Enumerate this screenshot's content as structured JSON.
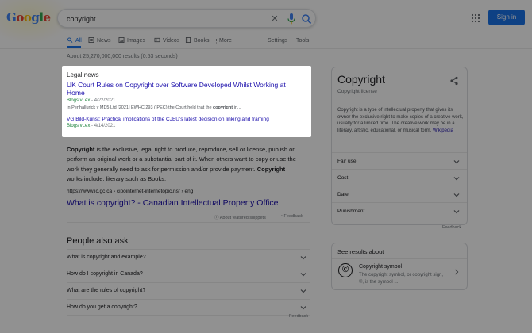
{
  "header": {
    "logo_text": "Google",
    "logo_colors": [
      "#4285f4",
      "#ea4335",
      "#fbbc05",
      "#4285f4",
      "#34a853",
      "#ea4335"
    ],
    "search_value": "copyright",
    "clear_icon": "close-icon",
    "mic_icon": "mic-icon",
    "search_icon": "search-icon",
    "apps_icon": "apps-grid-icon",
    "signin_label": "Sign in"
  },
  "tabs": {
    "items": [
      {
        "label": "All",
        "icon": "search-icon"
      },
      {
        "label": "News",
        "icon": "news-icon"
      },
      {
        "label": "Images",
        "icon": "image-icon"
      },
      {
        "label": "Videos",
        "icon": "video-icon"
      },
      {
        "label": "Books",
        "icon": "book-icon"
      },
      {
        "label": "More",
        "icon": "more-vert-icon"
      }
    ],
    "settings_label": "Settings",
    "tools_label": "Tools"
  },
  "result_stats": "About 25,270,000,000 results (0.53 seconds)",
  "legal_news": {
    "heading": "Legal news",
    "items": [
      {
        "title": "UK Court Rules on Copyright over Software Developed Whilst Working at Home",
        "source": "Blogs vLex",
        "date": " - 4/22/2021",
        "snippet_pre": "In Penhallurick v MD5 Ltd [2021] EWHC 293 (IPEC) the Court held that the ",
        "snippet_bold": "copyright",
        "snippet_post": " in..."
      },
      {
        "title": "VG Bild-Kunst: Practical implications of the CJEU's latest decision on linking and framing",
        "source": "Blogs vLex",
        "date": " - 4/14/2021"
      }
    ]
  },
  "featured_snippet": {
    "term": "Copyright",
    "text1": " is the exclusive, legal right to produce, reproduce, sell or license, publish or perform an original work or a substantial part of it. When others want to copy or use the work they generally need to ask for permission and/or provide payment. ",
    "term2": "Copyright",
    "text2": " works include: literary such as Books.",
    "cite_url": "https://www.ic.gc.ca › cipointernet-internetopic.nsf › eng",
    "cite_title": "What is copyright? - Canadian Intellectual Property Office",
    "about_label": "About featured snippets",
    "feedback_label": "Feedback"
  },
  "people_also_ask": {
    "heading": "People also ask",
    "questions": [
      "What is copyright and example?",
      "How do I copyright in Canada?",
      "What are the rules of copyright?",
      "How do you get a copyright?"
    ],
    "feedback_label": "Feedback"
  },
  "knowledge_panel": {
    "title": "Copyright",
    "subtitle": "Copyright license",
    "description": "Copyright is a type of intellectual property that gives its owner the exclusive right to make copies of a creative work, usually for a limited time. The creative work may be in a literary, artistic, educational, or musical form. ",
    "wiki_link": "Wikipedia",
    "rows": [
      "Fair use",
      "Cost",
      "Date",
      "Punishment"
    ],
    "feedback_label": "Feedback"
  },
  "see_results_about": {
    "heading": "See results about",
    "item_name": "Copyright symbol",
    "item_desc": "The copyright symbol, or copyright sign, ©, is the symbol ...",
    "item_icon": "©"
  },
  "colors": {
    "link": "#1a0dab",
    "accent": "#1a73e8",
    "source_green": "#188038",
    "overlay": "rgba(0,0,0,0.43)"
  }
}
